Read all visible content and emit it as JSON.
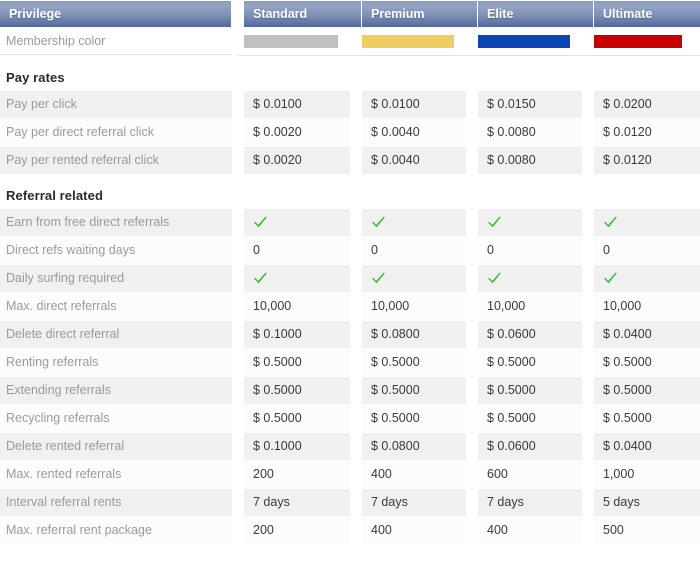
{
  "table": {
    "columns": [
      {
        "key": "privilege",
        "label": "Privilege"
      },
      {
        "key": "standard",
        "label": "Standard"
      },
      {
        "key": "premium",
        "label": "Premium"
      },
      {
        "key": "elite",
        "label": "Elite"
      },
      {
        "key": "ultimate",
        "label": "Ultimate"
      }
    ],
    "membership_color_row": {
      "label": "Membership color",
      "colors": {
        "standard": "#c0c0c0",
        "premium": "#edce5f",
        "elite": "#0b46b4",
        "ultimate": "#c80000"
      }
    },
    "sections": [
      {
        "title": "Pay rates",
        "rows": [
          {
            "label": "Pay per click",
            "standard": "$ 0.0100",
            "premium": "$ 0.0100",
            "elite": "$ 0.0150",
            "ultimate": "$ 0.0200"
          },
          {
            "label": "Pay per direct referral click",
            "standard": "$ 0.0020",
            "premium": "$ 0.0040",
            "elite": "$ 0.0080",
            "ultimate": "$ 0.0120"
          },
          {
            "label": "Pay per rented referral click",
            "standard": "$ 0.0020",
            "premium": "$ 0.0040",
            "elite": "$ 0.0080",
            "ultimate": "$ 0.0120"
          }
        ]
      },
      {
        "title": "Referral related",
        "rows": [
          {
            "label": "Earn from free direct referrals",
            "standard": "check-icon",
            "premium": "check-icon",
            "elite": "check-icon",
            "ultimate": "check-icon",
            "type": "check"
          },
          {
            "label": "Direct refs waiting days",
            "standard": "0",
            "premium": "0",
            "elite": "0",
            "ultimate": "0"
          },
          {
            "label": "Daily surfing required",
            "standard": "check-icon",
            "premium": "check-icon",
            "elite": "check-icon",
            "ultimate": "check-icon",
            "type": "check"
          },
          {
            "label": "Max. direct referrals",
            "standard": "10,000",
            "premium": "10,000",
            "elite": "10,000",
            "ultimate": "10,000"
          },
          {
            "label": "Delete direct referral",
            "standard": "$ 0.1000",
            "premium": "$ 0.0800",
            "elite": "$ 0.0600",
            "ultimate": "$ 0.0400"
          },
          {
            "label": "Renting referrals",
            "standard": "$ 0.5000",
            "premium": "$ 0.5000",
            "elite": "$ 0.5000",
            "ultimate": "$ 0.5000"
          },
          {
            "label": "Extending referrals",
            "standard": "$ 0.5000",
            "premium": "$ 0.5000",
            "elite": "$ 0.5000",
            "ultimate": "$ 0.5000"
          },
          {
            "label": "Recycling referrals",
            "standard": "$ 0.5000",
            "premium": "$ 0.5000",
            "elite": "$ 0.5000",
            "ultimate": "$ 0.5000"
          },
          {
            "label": "Delete rented referral",
            "standard": "$ 0.1000",
            "premium": "$ 0.0800",
            "elite": "$ 0.0600",
            "ultimate": "$ 0.0400"
          },
          {
            "label": "Max. rented referrals",
            "standard": "200",
            "premium": "400",
            "elite": "600",
            "ultimate": "1,000"
          },
          {
            "label": "Interval referral rents",
            "standard": "7 days",
            "premium": "7 days",
            "elite": "7 days",
            "ultimate": "5 days"
          },
          {
            "label": "Max. referral rent package",
            "standard": "200",
            "premium": "400",
            "elite": "400",
            "ultimate": "500"
          }
        ]
      }
    ]
  },
  "theme": {
    "header_gradient_top": "#93a2c2",
    "header_gradient_bottom": "#51689b",
    "header_text": "#ffffff",
    "label_text": "#9a9a9a",
    "value_text": "#3a3a3a",
    "stripe_odd": "#f0f0f0",
    "stripe_even": "#fcfcfc",
    "check_color": "#2db82d"
  }
}
